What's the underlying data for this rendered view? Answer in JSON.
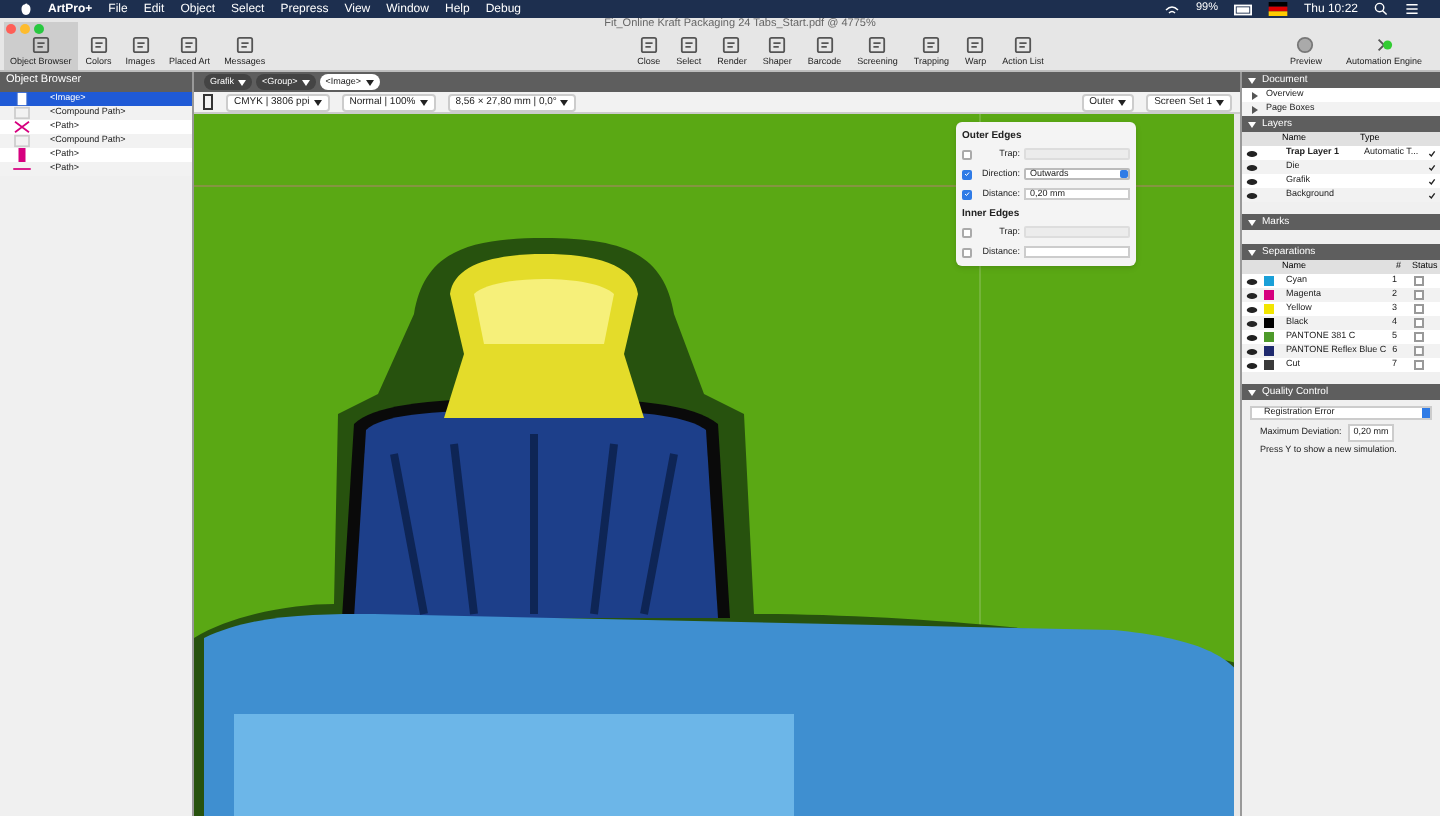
{
  "menu_bar": {
    "items": [
      "ArtPro+",
      "File",
      "Edit",
      "Object",
      "Select",
      "Prepress",
      "View",
      "Window",
      "Help",
      "Debug"
    ],
    "battery": "99%",
    "clock": "Thu 10:22"
  },
  "window": {
    "title": "Fit_Online Kraft Packaging 24 Tabs_Start.pdf @ 4775%"
  },
  "toolbar": {
    "left": [
      {
        "label": "Object Browser",
        "selected": true
      },
      {
        "label": "Colors",
        "selected": false
      },
      {
        "label": "Images",
        "selected": false
      },
      {
        "label": "Placed Art",
        "selected": false
      },
      {
        "label": "Messages",
        "selected": false
      }
    ],
    "center": [
      "Close",
      "Select",
      "Render",
      "Shaper",
      "Barcode",
      "Screening",
      "Trapping",
      "Warp",
      "Action List"
    ],
    "right": [
      "Preview",
      "Automation Engine"
    ]
  },
  "object_browser": {
    "title": "Object Browser",
    "rows": [
      {
        "label": "<Image>",
        "selected": true
      },
      {
        "label": "<Compound Path>",
        "selected": false
      },
      {
        "label": "<Path>",
        "selected": false
      },
      {
        "label": "<Compound Path>",
        "selected": false
      },
      {
        "label": "<Path>",
        "selected": false
      },
      {
        "label": "<Path>",
        "selected": false
      }
    ]
  },
  "breadcrumbs": [
    {
      "label": "Grafik",
      "selected": false
    },
    {
      "label": "<Group>",
      "selected": false
    },
    {
      "label": "<Image>",
      "selected": true
    }
  ],
  "canvas_toolbar": {
    "color_mode": "CMYK | 3806 ppi",
    "view": "Normal | 100%",
    "size": "8,56 × 27,80 mm | 0,0°",
    "edges": "Outer",
    "screen_set": "Screen Set 1"
  },
  "trap_popover": {
    "sections": [
      {
        "title": "Outer Edges",
        "fields": [
          {
            "label": "Trap:",
            "checked": false,
            "kind": "select"
          },
          {
            "label": "Direction:",
            "checked": true,
            "kind": "select",
            "value": "Outwards"
          },
          {
            "label": "Distance:",
            "checked": true,
            "kind": "input",
            "value": "0,20 mm"
          }
        ]
      },
      {
        "title": "Inner Edges",
        "fields": [
          {
            "label": "Trap:",
            "checked": false,
            "kind": "select"
          },
          {
            "label": "Distance:",
            "checked": false,
            "kind": "input"
          }
        ]
      }
    ]
  },
  "document": {
    "title": "Document",
    "items": [
      "Overview",
      "Page Boxes"
    ]
  },
  "layers": {
    "title": "Layers",
    "columns": [
      "Name",
      "Type"
    ],
    "rows": [
      {
        "name": "Trap Layer 1",
        "type": "Automatic T...",
        "active": true
      },
      {
        "name": "Die",
        "active": false
      },
      {
        "name": "Grafik",
        "active": false
      },
      {
        "name": "Background",
        "active": false
      }
    ]
  },
  "marks": {
    "title": "Marks"
  },
  "separations": {
    "title": "Separations",
    "columns": [
      "Name",
      "#",
      "Status"
    ],
    "rows": [
      {
        "name": "Cyan",
        "number": "1",
        "color": "#1aa0d8"
      },
      {
        "name": "Magenta",
        "number": "2",
        "color": "#d6007f"
      },
      {
        "name": "Yellow",
        "number": "3",
        "color": "#f2e500"
      },
      {
        "name": "Black",
        "number": "4",
        "color": "#000000"
      },
      {
        "name": "PANTONE 381 C",
        "number": "5",
        "color": "#4e9a2a"
      },
      {
        "name": "PANTONE Reflex Blue C",
        "number": "6",
        "color": "#1f2a6e"
      },
      {
        "name": "Cut",
        "number": "7",
        "color": "#3a3a3a"
      }
    ]
  },
  "quality_control": {
    "title": "Quality Control",
    "check": "Registration Error",
    "label": "Maximum Deviation:",
    "value": "0,20 mm",
    "hint": "Press Y to show a new simulation."
  }
}
